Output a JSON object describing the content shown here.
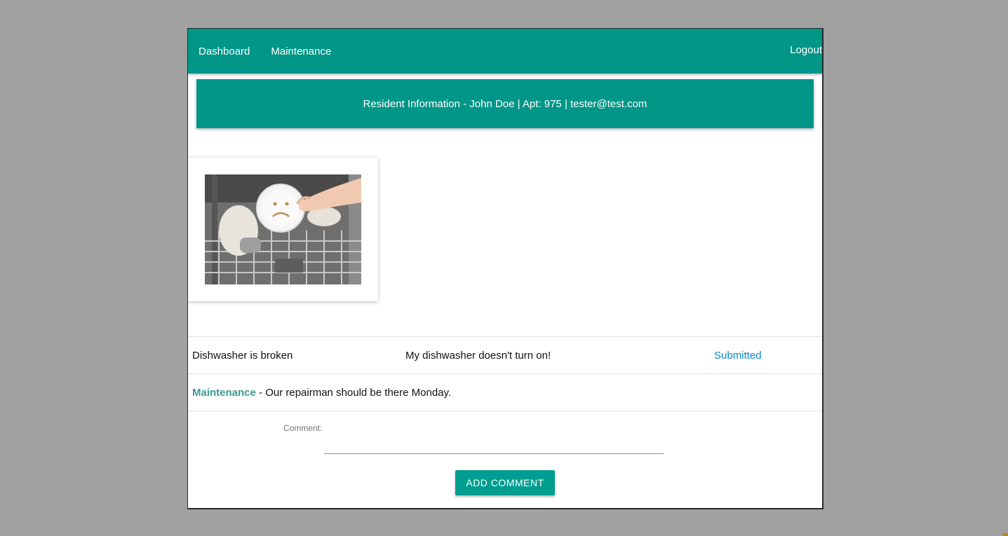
{
  "nav": {
    "dashboard": "Dashboard",
    "maintenance": "Maintenance",
    "logout": "Logout"
  },
  "resident": {
    "banner": "Resident Information - John Doe | Apt: 975 | tester@test.com"
  },
  "request": {
    "title": "Dishwasher is broken",
    "description": "My dishwasher doesn't turn on!",
    "status": "Submitted"
  },
  "comment": {
    "author": "Maintenance",
    "text": " - Our repairman should be there Monday."
  },
  "form": {
    "label": "Comment:",
    "value": "",
    "button": "ADD COMMENT"
  },
  "colors": {
    "accent": "#009688",
    "status": "#0288d1",
    "background": "#a1a1a1"
  }
}
